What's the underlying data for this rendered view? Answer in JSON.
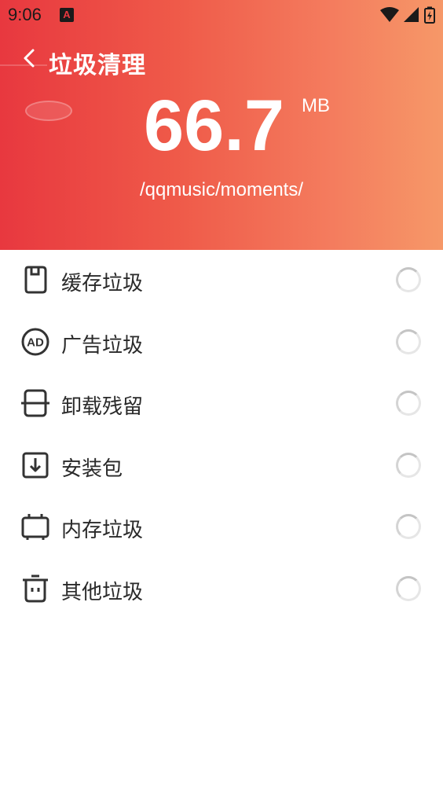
{
  "status_bar": {
    "time": "9:06",
    "app_icon_letter": "A"
  },
  "header": {
    "title": "垃圾清理",
    "size_value": "66.7",
    "size_unit": "MB",
    "scan_path": "/qqmusic/moments/"
  },
  "colors": {
    "gradient_start": "#e8383f",
    "gradient_end": "#f69868",
    "text_dark": "#2a2a2a",
    "icon_stroke": "#333333"
  },
  "list": {
    "items": [
      {
        "label": "缓存垃圾",
        "icon": "sd-card-icon"
      },
      {
        "label": "广告垃圾",
        "icon": "ad-icon"
      },
      {
        "label": "卸载残留",
        "icon": "uninstall-icon"
      },
      {
        "label": "安装包",
        "icon": "download-box-icon"
      },
      {
        "label": "内存垃圾",
        "icon": "memory-chip-icon"
      },
      {
        "label": "其他垃圾",
        "icon": "trash-bin-icon"
      }
    ]
  }
}
